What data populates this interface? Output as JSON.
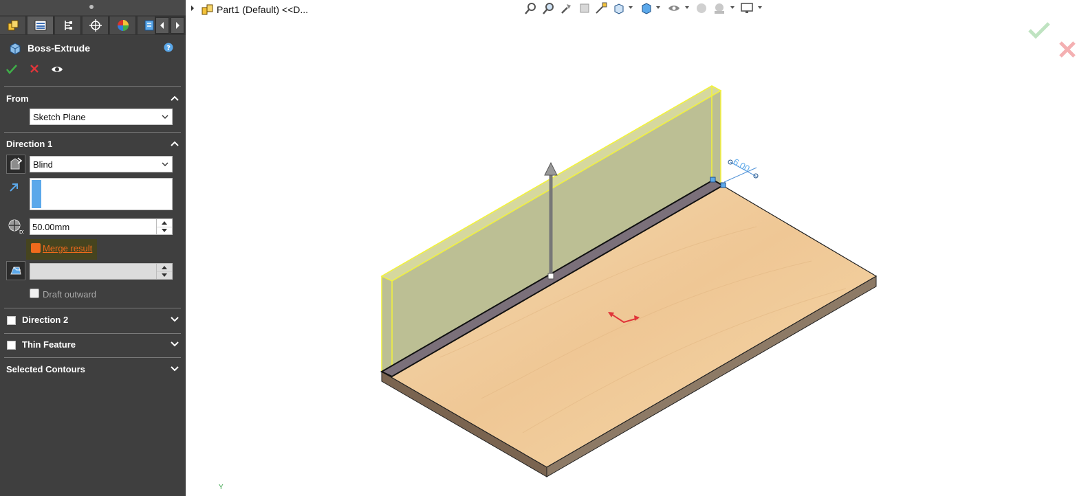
{
  "property_manager": {
    "title": "Boss-Extrude",
    "sections": {
      "from": {
        "label": "From",
        "start_condition": "Sketch Plane"
      },
      "direction1": {
        "label": "Direction 1",
        "end_condition": "Blind",
        "depth": "50.00mm",
        "merge_result_label": "Merge result",
        "merge_result_checked": true,
        "draft_angle": "",
        "draft_outward_label": "Draft outward",
        "draft_outward_checked": false
      },
      "direction2": {
        "label": "Direction 2",
        "checked": false
      },
      "thin_feature": {
        "label": "Thin Feature",
        "checked": false
      },
      "selected_contours": {
        "label": "Selected Contours"
      }
    }
  },
  "viewport": {
    "tree_item": "Part1 (Default) <<D...",
    "dimension_label": "6.00",
    "axis_label": "Y"
  },
  "colors": {
    "panel_bg": "#3f3f3f",
    "accent_orange": "#f06a1c",
    "ok_green": "#3fae49",
    "cancel_red": "#e0353a",
    "preview_yellow": "#f3f33a",
    "wood": "#f1cf9e"
  },
  "icons": {
    "tabs": [
      "feature-manager-icon",
      "property-manager-icon",
      "configuration-manager-icon",
      "dimxpert-icon",
      "appearance-icon",
      "custom-tab-icon"
    ],
    "view_toolbar": [
      "zoom-to-fit-icon",
      "zoom-to-area-icon",
      "previous-view-icon",
      "section-view-icon",
      "dynamic-annotation-icon",
      "view-orientation-icon",
      "display-style-icon",
      "hide-show-icon",
      "edit-appearance-icon",
      "apply-scene-icon",
      "view-settings-icon"
    ]
  }
}
